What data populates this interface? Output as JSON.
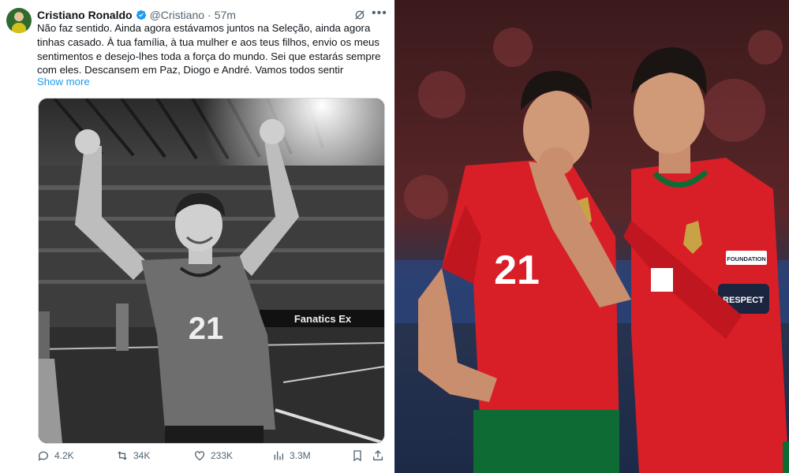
{
  "tweet": {
    "author_name": "Cristiano Ronaldo",
    "handle": "@Cristiano",
    "separator": "·",
    "time": "57m",
    "more_icon": "more-icon",
    "text_lines": [
      "Não faz sentido. Ainda agora estávamos juntos na Seleção, ainda agora",
      "tinhas casado. À tua família, à tua mulher e aos teus filhos, envio os meus",
      "sentimentos e desejo-lhes toda a força do mundo. Sei que estarás sempre",
      "com eles. Descansem em Paz, Diogo e André. Vamos todos sentir"
    ],
    "show_more": "Show more",
    "image": {
      "shirt_number": "21",
      "ad_board": "Fanatics Ex"
    },
    "actions": {
      "replies": "4.2K",
      "reposts": "34K",
      "likes": "233K",
      "views": "3.3M"
    }
  },
  "photo": {
    "left_shirt_number": "21",
    "badge_foundation": "FOUNDATION",
    "armband": "RESPECT"
  },
  "colors": {
    "accent": "#1d9bf0",
    "text_primary": "#0f1419",
    "text_secondary": "#536471",
    "kit_red": "#d81e27",
    "kit_green": "#0f6b34"
  }
}
